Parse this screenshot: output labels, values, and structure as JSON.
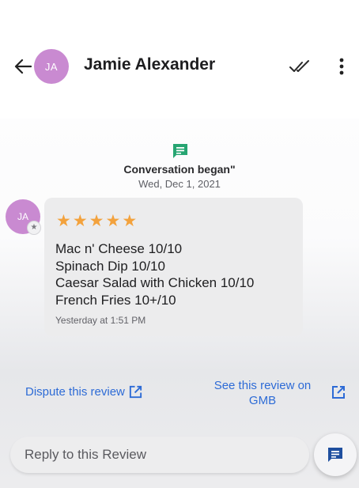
{
  "header": {
    "avatar_initials": "JA",
    "contact_name": "Jamie Alexander"
  },
  "conversation": {
    "started_label": "Conversation began\"",
    "started_date": "Wed, Dec 1, 2021"
  },
  "review": {
    "avatar_initials": "JA",
    "rating": 5,
    "star_glyph": "★",
    "lines": [
      "Mac n' Cheese 10/10",
      "Spinach Dip 10/10",
      "Caesar Salad with Chicken 10/10",
      "French Fries 10+/10"
    ],
    "timestamp": "Yesterday at 1:51 PM"
  },
  "actions": {
    "dispute_label": "Dispute this review",
    "gmb_label": "See this review on GMB"
  },
  "reply": {
    "placeholder": "Reply to this Review"
  },
  "colors": {
    "avatar": "#c98ad1",
    "star": "#f3a23d",
    "link": "#2d6bd6",
    "conversation_icon": "#27a572",
    "fab_icon": "#1f4f9f"
  },
  "icons": {
    "back": "arrow-left-icon",
    "read": "double-check-icon",
    "more": "more-vert-icon",
    "conversation": "chat-bubble-icon",
    "external": "open-external-icon",
    "fab": "message-icon"
  }
}
